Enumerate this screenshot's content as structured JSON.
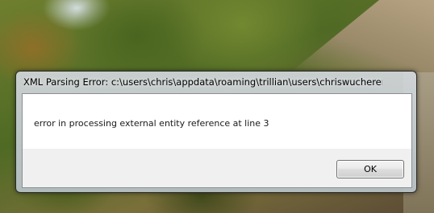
{
  "dialog": {
    "title": "XML Parsing Error: c:\\users\\chris\\appdata\\roaming\\trillian\\users\\chriswucherer\\...",
    "message": "error in processing external entity reference at line 3",
    "ok_label": "OK"
  },
  "colors": {
    "content_background": "#ffffff",
    "footer_background": "#f0f0f0"
  }
}
